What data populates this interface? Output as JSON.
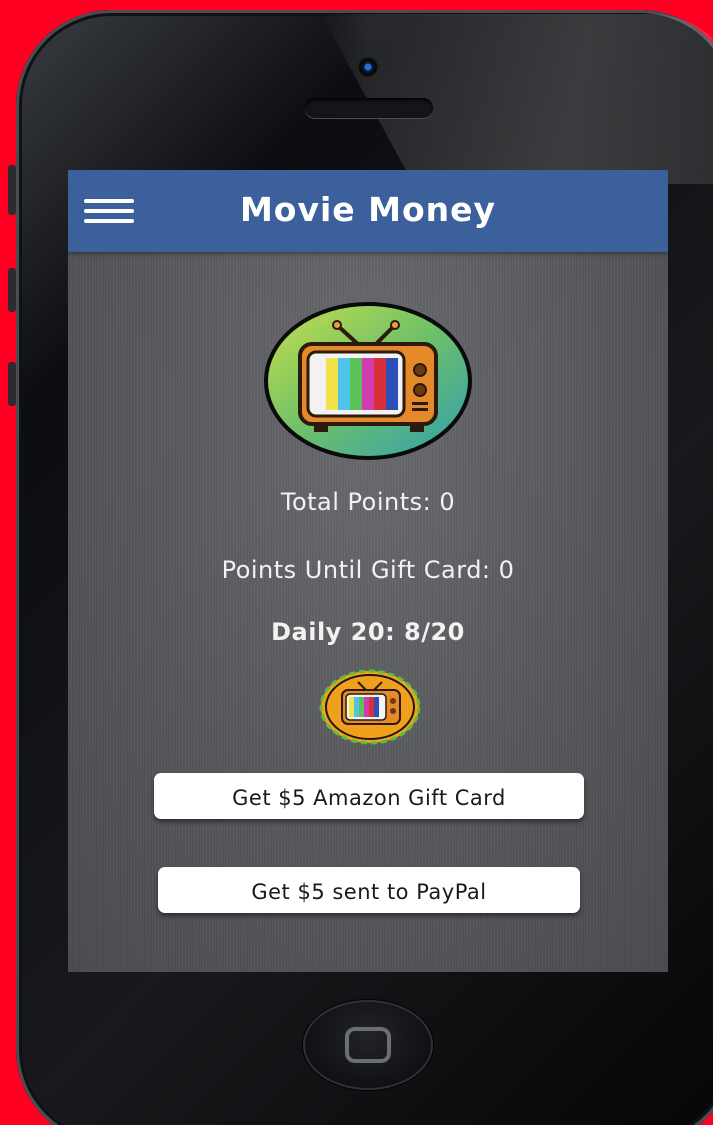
{
  "app": {
    "title": "Movie Money"
  },
  "stats": {
    "total_points": "Total Points: 0",
    "points_until_gift_card": "Points Until Gift Card: 0",
    "daily": "Daily 20: 8/20"
  },
  "actions": {
    "amazon_label": "Get $5 Amazon Gift Card",
    "paypal_label": "Get $5 sent to PayPal"
  },
  "icons": {
    "menu": "hamburger-menu-icon",
    "logo": "retro-tv-icon",
    "daily_button": "retro-tv-icon"
  },
  "colors": {
    "background": "#ff0022",
    "app_bar": "#3b609b",
    "screen": "#5a5c60",
    "button": "#ffffff"
  }
}
